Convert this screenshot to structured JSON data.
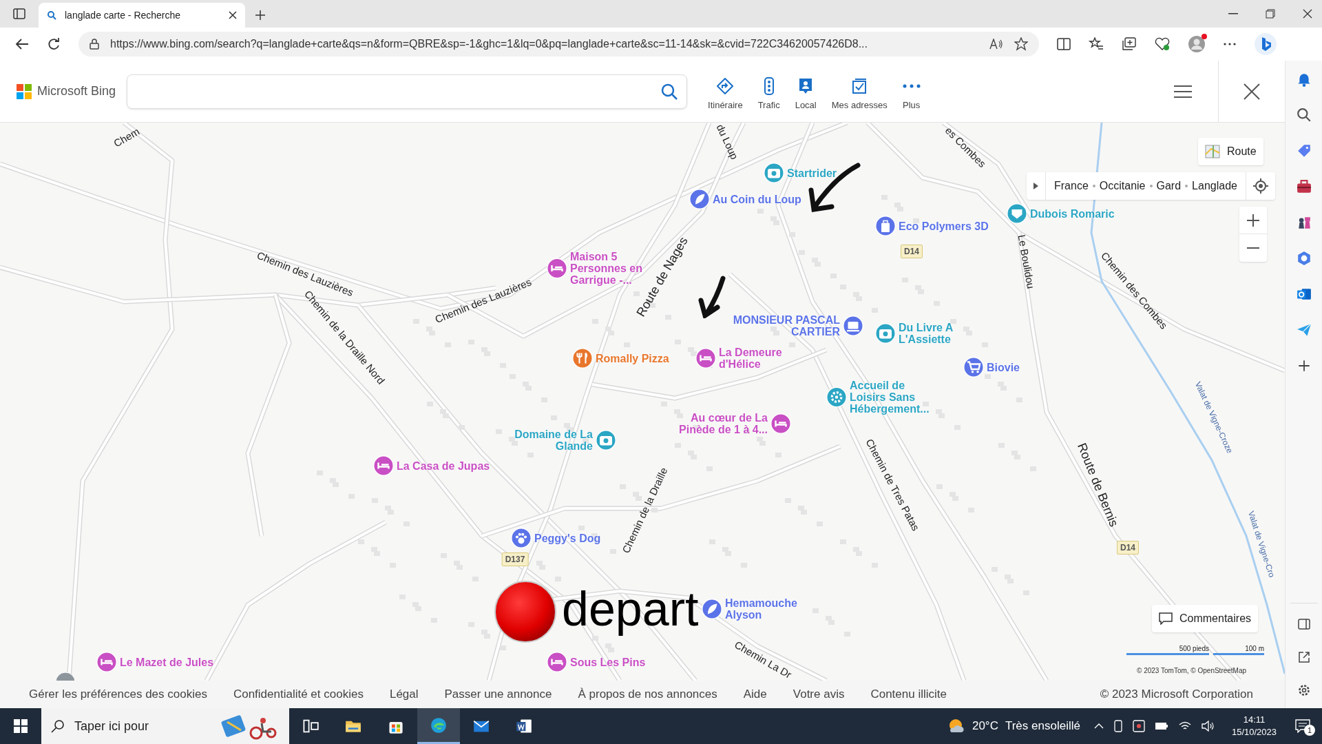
{
  "browser": {
    "tab_title": "langlade carte - Recherche",
    "url": "https://www.bing.com/search?q=langlade+carte&qs=n&form=QBRE&sp=-1&ghc=1&lq=0&pq=langlade+carte&sc=11-14&sk=&cvid=722C34620057426D8..."
  },
  "header": {
    "logo": "Microsoft Bing",
    "nav": [
      {
        "kind": "route",
        "label": "Itinéraire"
      },
      {
        "kind": "traffic",
        "label": "Trafic"
      },
      {
        "kind": "local",
        "label": "Local"
      },
      {
        "kind": "saved",
        "label": "Mes adresses"
      },
      {
        "kind": "more",
        "label": "Plus"
      }
    ]
  },
  "map": {
    "style_button": "Route",
    "breadcrumb": [
      "France",
      "Occitanie",
      "Gard",
      "Langlade"
    ],
    "pois": [
      {
        "name": "Startrider",
        "kind": "attraction",
        "color": "#2ba6c4"
      },
      {
        "name": "Au Coin du Loup",
        "kind": "leaf",
        "color": "#5b73e8"
      },
      {
        "name": "Eco Polymers 3D",
        "kind": "shop",
        "color": "#5b73e8"
      },
      {
        "name": "Dubois Romaric",
        "kind": "service",
        "color": "#2ba6c4"
      },
      {
        "name": "Maison 5 Personnes en Garrigue -...",
        "kind": "lodging",
        "color": "#c94fc4"
      },
      {
        "name": "MONSIEUR PASCAL CARTIER",
        "kind": "computer",
        "color": "#5b73e8"
      },
      {
        "name": "Du Livre A L'Assiette",
        "kind": "attraction",
        "color": "#2ba6c4"
      },
      {
        "name": "Romally Pizza",
        "kind": "food",
        "color": "#e8762c"
      },
      {
        "name": "La Demeure d'Hélice",
        "kind": "lodging",
        "color": "#c94fc4"
      },
      {
        "name": "Biovie",
        "kind": "cart",
        "color": "#5b73e8"
      },
      {
        "name": "Accueil de Loisirs Sans Hébergement...",
        "kind": "gear",
        "color": "#2ba6c4"
      },
      {
        "name": "Au cœur de La Pinède de 1 à 4...",
        "kind": "lodging",
        "color": "#c94fc4"
      },
      {
        "name": "Domaine de La Glande",
        "kind": "attraction",
        "color": "#2ba6c4"
      },
      {
        "name": "La Casa de Jupas",
        "kind": "lodging",
        "color": "#c94fc4"
      },
      {
        "name": "Peggy's Dog",
        "kind": "paw",
        "color": "#5b73e8"
      },
      {
        "name": "Hemamouche Alyson",
        "kind": "leaf",
        "color": "#5b73e8"
      },
      {
        "name": "Le Mazet de Jules",
        "kind": "lodging",
        "color": "#c94fc4"
      },
      {
        "name": "Sous Les Pins",
        "kind": "lodging",
        "color": "#c94fc4"
      }
    ],
    "roads": [
      "Chem",
      "du Loup",
      "es Combes",
      "Chemin des Lauzières",
      "Chemin de la Draille Nord",
      "Chemin des Lauzières",
      "Route de Nages",
      "Le Boulidou",
      "Chemin des Combes",
      "Valat de Vigne-Croze",
      "Chemin de Tres Patas",
      "Route de Bernis",
      "Chemin de la Draille",
      "Chemin La Dr",
      "Valat de Vigne-Cro"
    ],
    "shields": [
      "D14",
      "D137",
      "D14"
    ],
    "marker_label": "depart",
    "feedback_button": "Commentaires",
    "scale": [
      "500 pieds",
      "100 m"
    ],
    "copyright": "© 2023 TomTom, © OpenStreetMap"
  },
  "footer": {
    "links": [
      "Gérer les préférences des cookies",
      "Confidentialité et cookies",
      "Légal",
      "Passer une annonce",
      "À propos de nos annonces",
      "Aide",
      "Votre avis",
      "Contenu illicite"
    ],
    "copyright": "© 2023 Microsoft Corporation"
  },
  "taskbar": {
    "search_placeholder": "Taper ici pour",
    "weather": {
      "temp": "20°C",
      "desc": "Très ensoleillé"
    },
    "time": "14:11",
    "date": "15/10/2023",
    "notifications": "1"
  }
}
